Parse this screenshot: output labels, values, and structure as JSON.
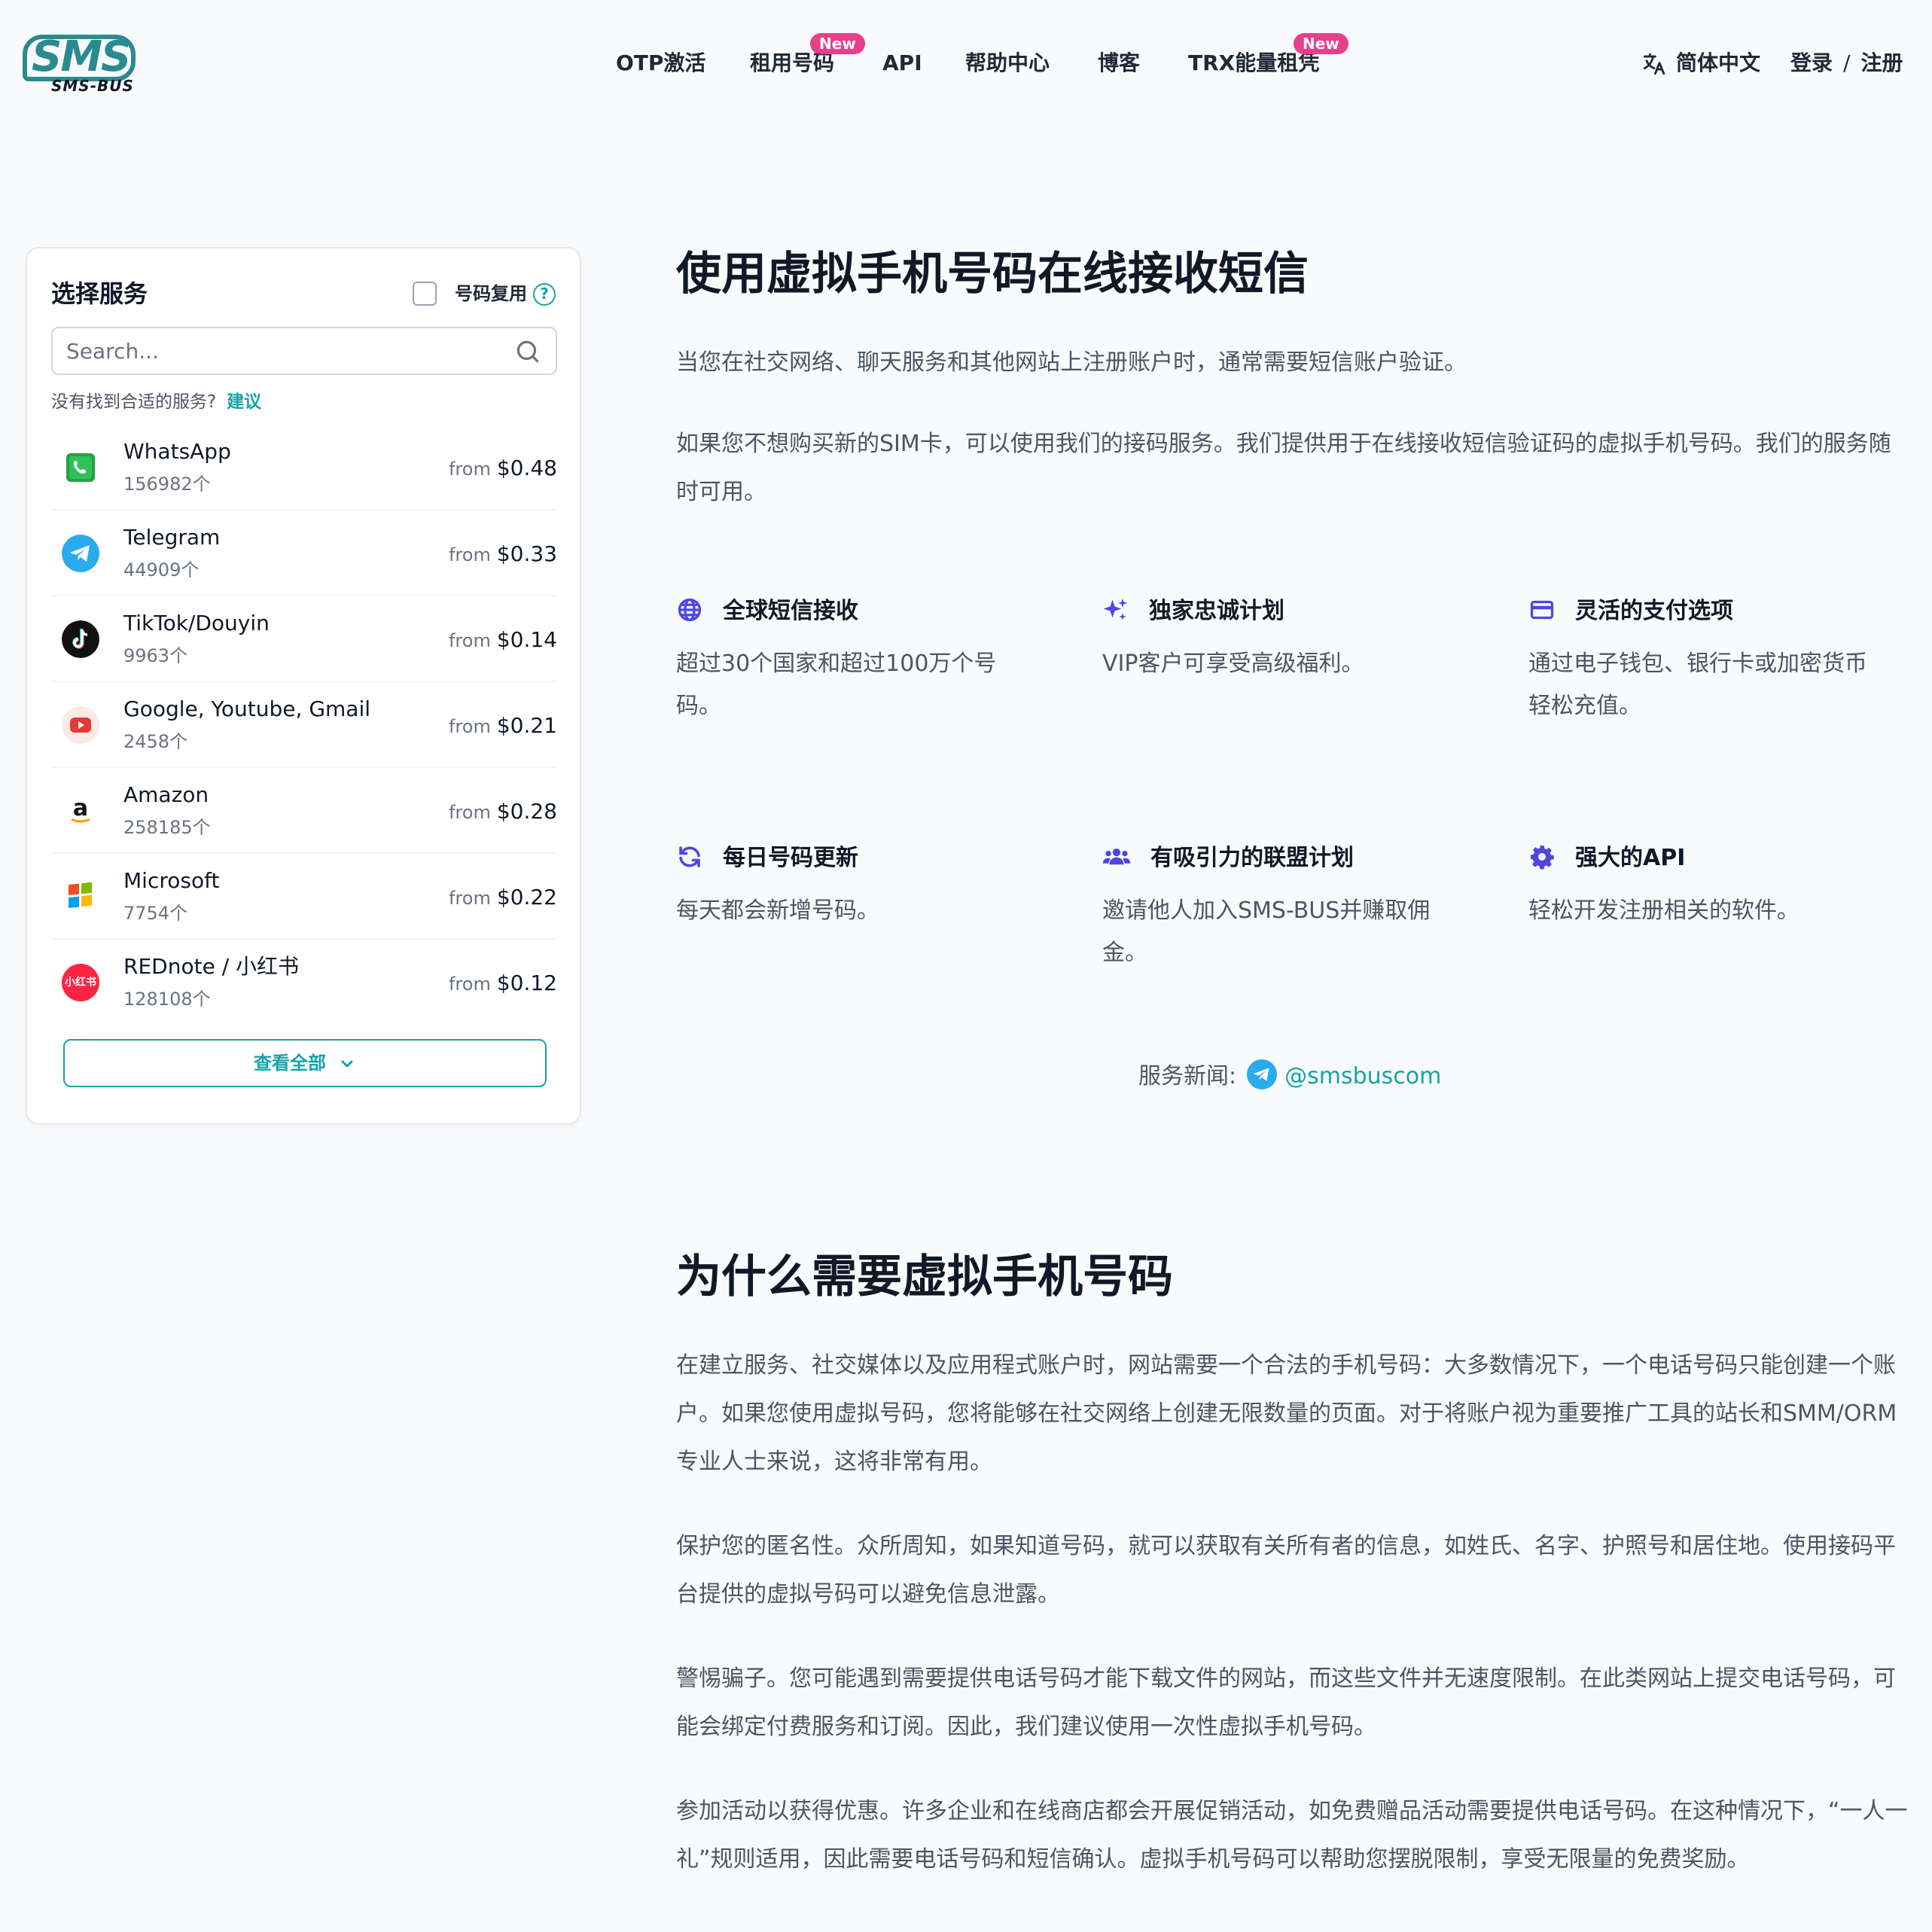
{
  "brand": {
    "logo_text": "SMS",
    "logo_sub": "SMS-BUS",
    "primary_color": "#14a3a8",
    "badge_color": "#e83e8c"
  },
  "nav": {
    "items": [
      {
        "label": "OTP激活",
        "badge": ""
      },
      {
        "label": "租用号码",
        "badge": "New"
      },
      {
        "label": "API",
        "badge": ""
      },
      {
        "label": "帮助中心",
        "badge": ""
      },
      {
        "label": "博客",
        "badge": ""
      },
      {
        "label": "TRX能量租凭",
        "badge": "New"
      }
    ],
    "language": "简体中文",
    "login": "登录",
    "separator": "/",
    "register": "注册"
  },
  "sidebar": {
    "title": "选择服务",
    "reuse_label": "号码复用",
    "help_glyph": "?",
    "search_placeholder": "Search...",
    "suggest_text": "没有找到合适的服务?",
    "suggest_link": "建议",
    "from_label": "from",
    "services": [
      {
        "name": "WhatsApp",
        "count": "156982个",
        "price": "$0.48",
        "icon": "whatsapp-icon"
      },
      {
        "name": "Telegram",
        "count": "44909个",
        "price": "$0.33",
        "icon": "telegram-icon"
      },
      {
        "name": "TikTok/Douyin",
        "count": "9963个",
        "price": "$0.14",
        "icon": "tiktok-icon"
      },
      {
        "name": "Google, Youtube, Gmail",
        "count": "2458个",
        "price": "$0.21",
        "icon": "youtube-icon"
      },
      {
        "name": "Amazon",
        "count": "258185个",
        "price": "$0.28",
        "icon": "amazon-icon"
      },
      {
        "name": "Microsoft",
        "count": "7754个",
        "price": "$0.22",
        "icon": "microsoft-icon"
      },
      {
        "name": "REDnote / 小红书",
        "count": "128108个",
        "price": "$0.12",
        "icon": "rednote-icon",
        "icon_text": "小红书"
      }
    ],
    "view_all": "查看全部"
  },
  "main": {
    "title": "使用虚拟手机号码在线接收短信",
    "intro1": "当您在社交网络、聊天服务和其他网站上注册账户时，通常需要短信账户验证。",
    "intro2": "如果您不想购买新的SIM卡，可以使用我们的接码服务。我们提供用于在线接收短信验证码的虚拟手机号码。我们的服务随时可用。",
    "features": [
      {
        "title": "全球短信接收",
        "desc": "超过30个国家和超过100万个号码。",
        "icon": "globe-icon"
      },
      {
        "title": "独家忠诚计划",
        "desc": "VIP客户可享受高级福利。",
        "icon": "sparkles-icon"
      },
      {
        "title": "灵活的支付选项",
        "desc": "通过电子钱包、银行卡或加密货币轻松充值。",
        "icon": "credit-card-icon"
      },
      {
        "title": "每日号码更新",
        "desc": "每天都会新增号码。",
        "icon": "refresh-icon"
      },
      {
        "title": "有吸引力的联盟计划",
        "desc": "邀请他人加入SMS-BUS并赚取佣金。",
        "icon": "users-icon"
      },
      {
        "title": "强大的API",
        "desc": "轻松开发注册相关的软件。",
        "icon": "gear-icon"
      }
    ],
    "news_label": "服务新闻:",
    "news_handle": "@smsbuscom",
    "why_title": "为什么需要虚拟手机号码",
    "why_paragraphs": [
      "在建立服务、社交媒体以及应用程式账户时，网站需要一个合法的手机号码：大多数情况下，一个电话号码只能创建一个账户。如果您使用虚拟号码，您将能够在社交网络上创建无限数量的页面。对于将账户视为重要推广工具的站长和SMM/ORM专业人士来说，这将非常有用。",
      "保护您的匿名性。众所周知，如果知道号码，就可以获取有关所有者的信息，如姓氏、名字、护照号和居住地。使用接码平台提供的虚拟号码可以避免信息泄露。",
      "警惕骗子。您可能遇到需要提供电话号码才能下载文件的网站，而这些文件并无速度限制。在此类网站上提交电话号码，可能会绑定付费服务和订阅。因此，我们建议使用一次性虚拟手机号码。",
      "参加活动以获得优惠。许多企业和在线商店都会开展促销活动，如免费赠品活动需要提供电话号码。在这种情况下，“一人一礼”规则适用，因此需要电话号码和短信确认。虚拟手机号码可以帮助您摆脱限制，享受无限量的免费奖励。"
    ]
  }
}
